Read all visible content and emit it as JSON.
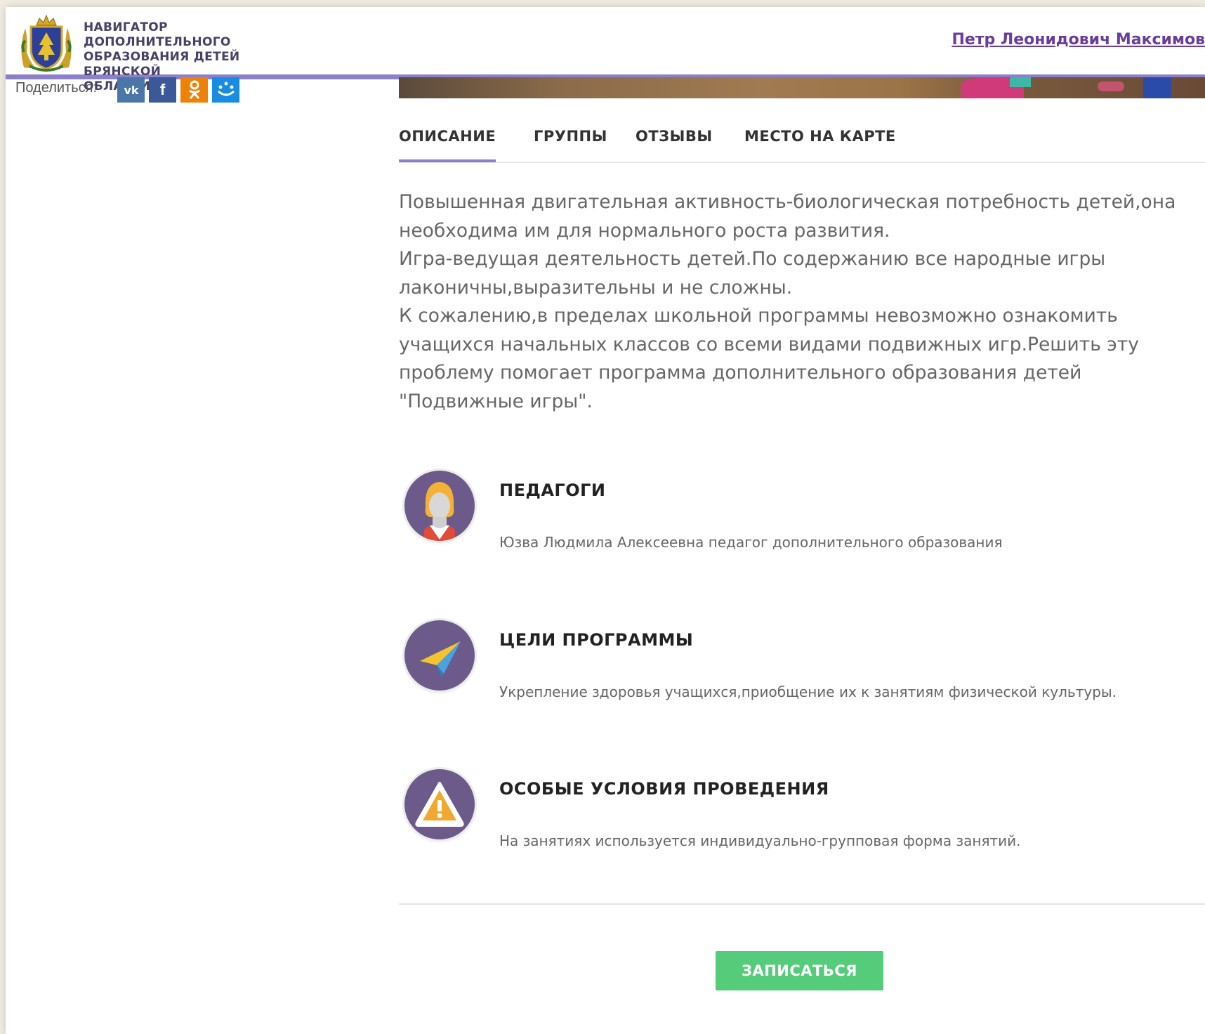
{
  "header": {
    "brand_lines": [
      "НАВИГАТОР ДОПОЛНИТЕЛЬНОГО",
      "ОБРАЗОВАНИЯ ДЕТЕЙ БРЯНСКОЙ",
      "ОБЛАСТИ"
    ],
    "user_name": "Петр Леонидович Максимов"
  },
  "share": {
    "label": "Поделиться:",
    "icons": [
      {
        "name": "vk-icon",
        "glyph": "vk"
      },
      {
        "name": "facebook-icon",
        "glyph": "f"
      },
      {
        "name": "odnoklassniki-icon",
        "glyph": "ok"
      },
      {
        "name": "mymail-icon",
        "glyph": "@"
      }
    ]
  },
  "tabs": {
    "description": "ОПИСАНИЕ",
    "groups": "ГРУППЫ",
    "reviews": "ОТЗЫВЫ",
    "map": "МЕСТО НА КАРТЕ",
    "active": "description"
  },
  "description": {
    "text": "Повышенная двигательная активность-биологическая потребность детей,она\nнеобходима им для нормального роста развития.\nИгра-ведущая деятельность детей.По содержанию все народные игры\nлаконичны,выразительны и не сложны.\nК сожалению,в пределах школьной программы невозможно ознакомить\nучащихся начальных классов со всеми видами подвижных игр.Решить эту\nпроблему помогает программа дополнительного образования детей\n\"Подвижные игры\"."
  },
  "sections": {
    "teachers": {
      "title": "ПЕДАГОГИ",
      "text": "Юзва Людмила Алексеевна педагог дополнительного образования",
      "icon": "teacher-avatar-icon"
    },
    "goals": {
      "title": "ЦЕЛИ ПРОГРАММЫ",
      "text": "Укрепление здоровья учащихся,приобщение их к занятиям физической культуры.",
      "icon": "paper-plane-icon"
    },
    "conditions": {
      "title": "ОСОБЫЕ УСЛОВИЯ ПРОВЕДЕНИЯ",
      "text": "На занятиях используется индивидуально-групповая форма занятий.",
      "icon": "warning-icon"
    }
  },
  "actions": {
    "enroll_label": "ЗАПИСАТЬСЯ"
  },
  "colors": {
    "accent": "#8b80c9",
    "link": "#6a3d9a",
    "enroll": "#54cc79",
    "icon_circle": "#6b5a8a"
  }
}
